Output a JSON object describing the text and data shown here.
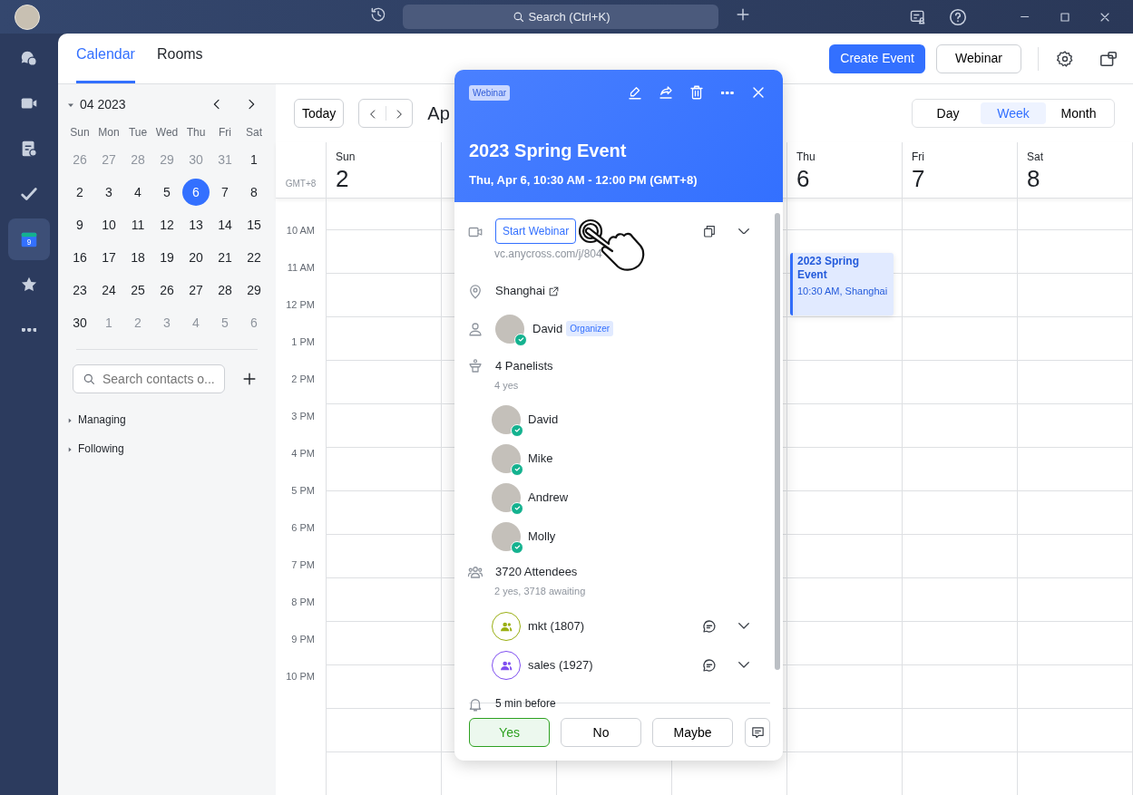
{
  "window": {
    "search_placeholder": "Search (Ctrl+K)"
  },
  "rail": [
    {
      "kind": "chat",
      "selected": false
    },
    {
      "kind": "video",
      "selected": false
    },
    {
      "kind": "docs",
      "selected": false
    },
    {
      "kind": "tasks",
      "selected": false
    },
    {
      "kind": "calendar",
      "selected": true,
      "icon_text": "9"
    },
    {
      "kind": "star",
      "selected": false
    },
    {
      "kind": "more",
      "selected": false
    }
  ],
  "tabs": [
    {
      "label": "Calendar",
      "selected": true
    },
    {
      "label": "Rooms",
      "selected": false
    }
  ],
  "header_buttons": {
    "create": "Create Event",
    "webinar": "Webinar"
  },
  "mini_calendar": {
    "title": "04 2023",
    "weekdays": [
      "Sun",
      "Mon",
      "Tue",
      "Wed",
      "Thu",
      "Fri",
      "Sat"
    ],
    "weeks": [
      [
        {
          "d": "26",
          "muted": true,
          "selected": false
        },
        {
          "d": "27",
          "muted": true,
          "selected": false
        },
        {
          "d": "28",
          "muted": true,
          "selected": false
        },
        {
          "d": "29",
          "muted": true,
          "selected": false
        },
        {
          "d": "30",
          "muted": true,
          "selected": false
        },
        {
          "d": "31",
          "muted": true,
          "selected": false
        },
        {
          "d": "1",
          "muted": false,
          "selected": false
        }
      ],
      [
        {
          "d": "2",
          "muted": false,
          "selected": false
        },
        {
          "d": "3",
          "muted": false,
          "selected": false
        },
        {
          "d": "4",
          "muted": false,
          "selected": false
        },
        {
          "d": "5",
          "muted": false,
          "selected": false
        },
        {
          "d": "6",
          "muted": false,
          "selected": true
        },
        {
          "d": "7",
          "muted": false,
          "selected": false
        },
        {
          "d": "8",
          "muted": false,
          "selected": false
        }
      ],
      [
        {
          "d": "9",
          "muted": false,
          "selected": false
        },
        {
          "d": "10",
          "muted": false,
          "selected": false
        },
        {
          "d": "11",
          "muted": false,
          "selected": false
        },
        {
          "d": "12",
          "muted": false,
          "selected": false
        },
        {
          "d": "13",
          "muted": false,
          "selected": false
        },
        {
          "d": "14",
          "muted": false,
          "selected": false
        },
        {
          "d": "15",
          "muted": false,
          "selected": false
        }
      ],
      [
        {
          "d": "16",
          "muted": false,
          "selected": false
        },
        {
          "d": "17",
          "muted": false,
          "selected": false
        },
        {
          "d": "18",
          "muted": false,
          "selected": false
        },
        {
          "d": "19",
          "muted": false,
          "selected": false
        },
        {
          "d": "20",
          "muted": false,
          "selected": false
        },
        {
          "d": "21",
          "muted": false,
          "selected": false
        },
        {
          "d": "22",
          "muted": false,
          "selected": false
        }
      ],
      [
        {
          "d": "23",
          "muted": false,
          "selected": false
        },
        {
          "d": "24",
          "muted": false,
          "selected": false
        },
        {
          "d": "25",
          "muted": false,
          "selected": false
        },
        {
          "d": "26",
          "muted": false,
          "selected": false
        },
        {
          "d": "27",
          "muted": false,
          "selected": false
        },
        {
          "d": "28",
          "muted": false,
          "selected": false
        },
        {
          "d": "29",
          "muted": false,
          "selected": false
        }
      ],
      [
        {
          "d": "30",
          "muted": false,
          "selected": false
        },
        {
          "d": "1",
          "muted": true,
          "selected": false
        },
        {
          "d": "2",
          "muted": true,
          "selected": false
        },
        {
          "d": "3",
          "muted": true,
          "selected": false
        },
        {
          "d": "4",
          "muted": true,
          "selected": false
        },
        {
          "d": "5",
          "muted": true,
          "selected": false
        },
        {
          "d": "6",
          "muted": true,
          "selected": false
        }
      ]
    ]
  },
  "contact_search": {
    "placeholder": "Search contacts o..."
  },
  "sections": [
    {
      "label": "Managing",
      "expanded": false
    },
    {
      "label": "Following",
      "expanded": false
    }
  ],
  "toolbar": {
    "today": "Today",
    "title": "Ap",
    "views": [
      {
        "label": "Day",
        "selected": false
      },
      {
        "label": "Week",
        "selected": true
      },
      {
        "label": "Month",
        "selected": false
      }
    ]
  },
  "timezone": "GMT+8",
  "days_left": [
    {
      "weekday": "Sun",
      "date": "2"
    }
  ],
  "days_right": [
    {
      "weekday": "Thu",
      "date": "6"
    },
    {
      "weekday": "Fri",
      "date": "7"
    },
    {
      "weekday": "Sat",
      "date": "8"
    }
  ],
  "time_labels": [
    "10 AM",
    "11 AM",
    "12 PM",
    "1 PM",
    "2 PM",
    "3 PM",
    "4 PM",
    "5 PM",
    "6 PM",
    "7 PM",
    "8 PM",
    "9 PM",
    "10 PM"
  ],
  "event": {
    "title": "2023 Spring Event",
    "subtitle": "10:30 AM, Shanghai"
  },
  "popover": {
    "tag": "Webinar",
    "title": "2023 Spring Event",
    "when": "Thu, Apr 6, 10:30 AM - 12:00 PM (GMT+8)",
    "start_button": "Start Webinar",
    "link": "vc.anycross.com/j/804",
    "location": "Shanghai",
    "organizer": {
      "name": "David",
      "role": "Organizer",
      "accepted": true
    },
    "panelists_title": "4 Panelists",
    "panelists_summary": "4 yes",
    "panelists": [
      {
        "name": "David",
        "accepted": true
      },
      {
        "name": "Mike",
        "accepted": true
      },
      {
        "name": "Andrew",
        "accepted": true
      },
      {
        "name": "Molly",
        "accepted": true
      }
    ],
    "attendees_title": "3720 Attendees",
    "attendees_summary": "2 yes, 3718 awaiting",
    "groups": [
      {
        "name": "mkt (1807)",
        "color": "#9aaf12"
      },
      {
        "name": "sales (1927)",
        "color": "#7f4ff0"
      }
    ],
    "reminder": "5 min before",
    "rsvp": [
      {
        "label": "Yes",
        "selected": true
      },
      {
        "label": "No",
        "selected": false
      },
      {
        "label": "Maybe",
        "selected": false
      }
    ]
  }
}
